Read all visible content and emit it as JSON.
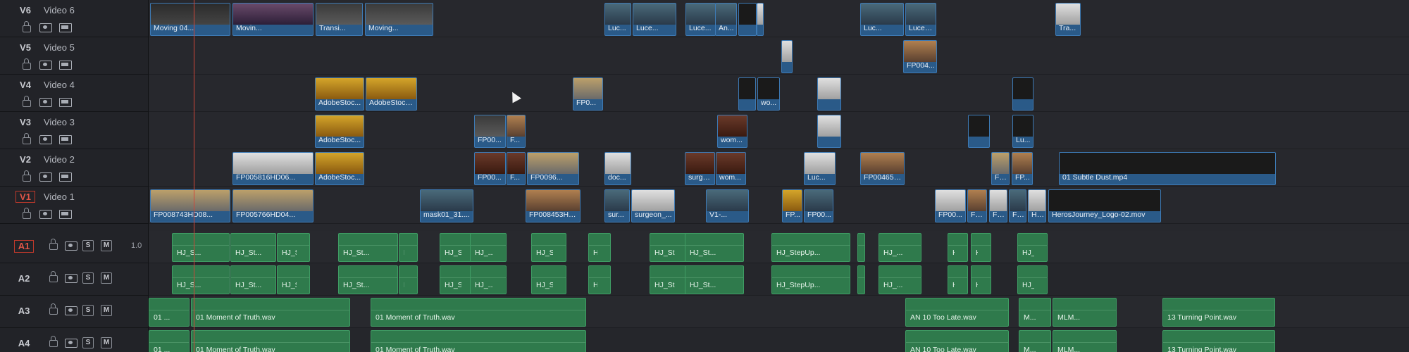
{
  "video_tracks": [
    {
      "id": "V6",
      "name": "Video 6",
      "selected": false
    },
    {
      "id": "V5",
      "name": "Video 5",
      "selected": false
    },
    {
      "id": "V4",
      "name": "Video 4",
      "selected": false
    },
    {
      "id": "V3",
      "name": "Video 3",
      "selected": false
    },
    {
      "id": "V2",
      "name": "Video 2",
      "selected": false
    },
    {
      "id": "V1",
      "name": "Video 1",
      "selected": true
    }
  ],
  "audio_tracks": [
    {
      "id": "A1",
      "volume": "1.0",
      "selected": true
    },
    {
      "id": "A2",
      "volume": "",
      "selected": false
    },
    {
      "id": "A3",
      "volume": "",
      "selected": false
    },
    {
      "id": "A4",
      "volume": "",
      "selected": false
    }
  ],
  "audio_buttons": {
    "solo": "S",
    "mute": "M"
  },
  "video_clips": {
    "V6": [
      "Moving 04...",
      "Movin...",
      "Transi...",
      "Moving...",
      "Luc...",
      "Luce...",
      "Luce...",
      "An...",
      "",
      "",
      "Luc...",
      "Lucen...",
      "Tra..."
    ],
    "V5": [
      "",
      "FP004..."
    ],
    "V4": [
      "AdobeStoc...",
      "AdobeStock...",
      "FP0...",
      "",
      "wo...",
      "",
      "",
      "Lu..."
    ],
    "V3": [
      "AdobeStoc...",
      "FP00...",
      "F...",
      "wom...",
      "",
      "",
      "Lu...",
      "Lu..."
    ],
    "V2": [
      "FP005816HD06...",
      "AdobeStoc...",
      "FP00...",
      "F...",
      "FP0096...",
      "doc...",
      "surge...",
      "wom...",
      "Luc...",
      "FP004658...",
      "FP...",
      "FP...",
      "01 Subtle Dust.mp4"
    ],
    "V1": [
      "FP008743HD08...",
      "FP005766HD04...",
      "mask01_31....",
      "FP008453HD...",
      "sur...",
      "surgeon_...",
      "V1-...",
      "FP...",
      "FP00...",
      "FP00...",
      "FP...",
      "FP...",
      "FP...",
      "Herosjourney_Logo-01.mov",
      "HerosJourney_Logo-02.mov"
    ]
  },
  "audio_clips": {
    "A1": [
      "HJ_S...",
      "HJ_St...",
      "HJ_Ste...",
      "HJ_St...",
      "HJ_...",
      "HJ_St...",
      "HJ_...",
      "HJ_Ste...",
      "HJ_...",
      "HJ_Ste...",
      "HJ_St...",
      "HJ_StepUp...",
      "HJ_S...",
      "HJ_...",
      "HJ_...",
      "HJ_...",
      "HJ_..."
    ],
    "A2": [
      "HJ_S...",
      "HJ_St...",
      "HJ_Ste...",
      "HJ_St...",
      "HJ_...",
      "HJ_St...",
      "HJ_...",
      "HJ_Ste...",
      "HJ_...",
      "HJ_Ste...",
      "HJ_St...",
      "HJ_StepUp...",
      "HJ_S...",
      "HJ_...",
      "HJ_...",
      "HJ_...",
      "HJ_..."
    ],
    "A3": [
      "01 ...",
      "01 Moment of Truth.wav",
      "01 Moment of Truth.wav",
      "AN 10 Too Late.wav",
      "M...",
      "MLM...",
      "13 Turning Point.wav"
    ],
    "A4": [
      "01 ...",
      "01 Moment of Truth.wav",
      "01 Moment of Truth.wav",
      "AN 10 Too Late.wav",
      "M...",
      "MLM...",
      "13 Turning Point.wav"
    ]
  }
}
